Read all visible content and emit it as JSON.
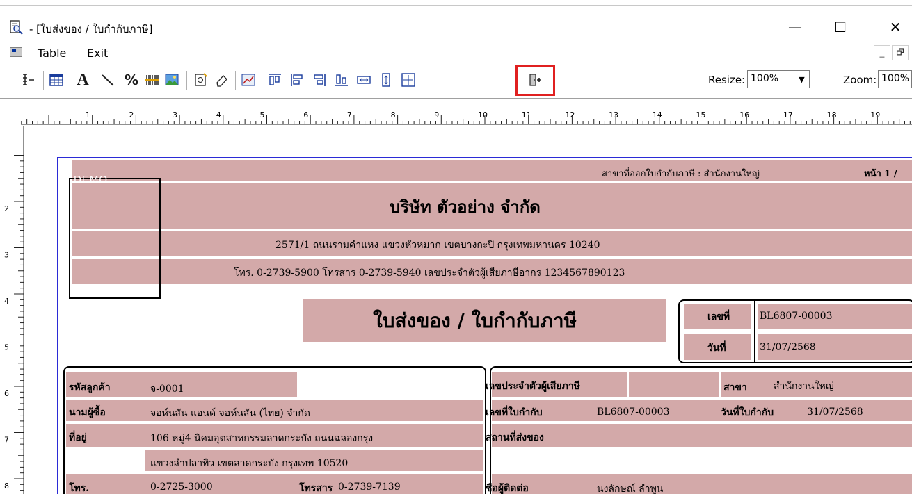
{
  "window": {
    "title": "- [ใบส่งของ / ใบกำกับภาษี]",
    "min_glyph": "—",
    "max_glyph": "☐",
    "close_glyph": "✕"
  },
  "menu": {
    "table_label": "Table",
    "exit_label": "Exit",
    "mdi_min_glyph": "_",
    "mdi_restore_glyph": "🗗"
  },
  "toolbar": {
    "resize_label": "Resize:",
    "resize_value": "100%",
    "zoom_label": "Zoom:",
    "zoom_value": "100%",
    "icons": [
      "field-list-icon",
      "table-grid-icon",
      "text-icon",
      "line-icon",
      "percent-icon",
      "barcode-icon",
      "image-icon",
      "new-object-icon",
      "eraser-icon",
      "chart-icon",
      "align-top-icon",
      "align-left-icon",
      "align-right-icon",
      "align-bottom-icon",
      "same-width-icon",
      "same-height-icon",
      "center-icon",
      "exit-icon"
    ]
  },
  "ruler": {
    "h_numbers": [
      "1",
      "2",
      "3",
      "4",
      "5",
      "6",
      "7",
      "8",
      "9",
      "10",
      "11",
      "12",
      "13",
      "14",
      "15",
      "16",
      "17",
      "18",
      "19"
    ],
    "v_numbers": [
      "2",
      "3",
      "4",
      "5",
      "6",
      "7",
      "8"
    ]
  },
  "report": {
    "demo_watermark": "DEMO",
    "branch_label": "สาขาที่ออกใบกำกับภาษี : สำนักงานใหญ่",
    "page_label": "หน้า 1 /",
    "company_name": "บริษัท ตัวอย่าง จำกัด",
    "address_line": "2571/1 ถนนรามคำแหง แขวงหัวหมาก เขตบางกะปิ กรุงเทพมหานคร 10240",
    "contact_line": "โทร. 0-2739-5900  โทรสาร 0-2739-5940  เลขประจำตัวผู้เสียภาษีอากร 1234567890123",
    "doc_title": "ใบส่งของ / ใบกำกับภาษี",
    "doc_no_label": "เลขที่",
    "doc_no_value": "BL6807-00003",
    "doc_date_label": "วันที่",
    "doc_date_value": "31/07/2568",
    "customer": {
      "code_label": "รหัสลูกค้า",
      "code_value": "จ-0001",
      "name_label": "นามผู้ซื้อ",
      "name_value": "จอห์นสัน แอนด์ จอห์นสัน (ไทย) จำกัด",
      "address_label": "ที่อยู่",
      "address_line1": "106 หมู่4 นิคมอุตสาหกรรมลาดกระบัง ถนนฉลองกรุง",
      "address_line2": "แขวงลำปลาทิว เขตลาดกระบัง กรุงเทพ 10520",
      "phone_label": "โทร.",
      "phone_value": "0-2725-3000",
      "fax_label": "โทรสาร",
      "fax_value": "0-2739-7139"
    },
    "tax": {
      "taxid_label": "เลขประจำตัวผู้เสียภาษี",
      "branch_label": "สาขา",
      "branch_value": "สำนักงานใหญ่",
      "invoice_no_label": "เลขที่ใบกำกับ",
      "invoice_no_value": "BL6807-00003",
      "invoice_date_label": "วันที่ใบกำกับ",
      "invoice_date_value": "31/07/2568",
      "ship_to_label": "สถานที่ส่งของ",
      "contact_label": "ชื่อผู้ติดต่อ",
      "contact_value": "นงลักษณ์ ลำพูน"
    }
  }
}
